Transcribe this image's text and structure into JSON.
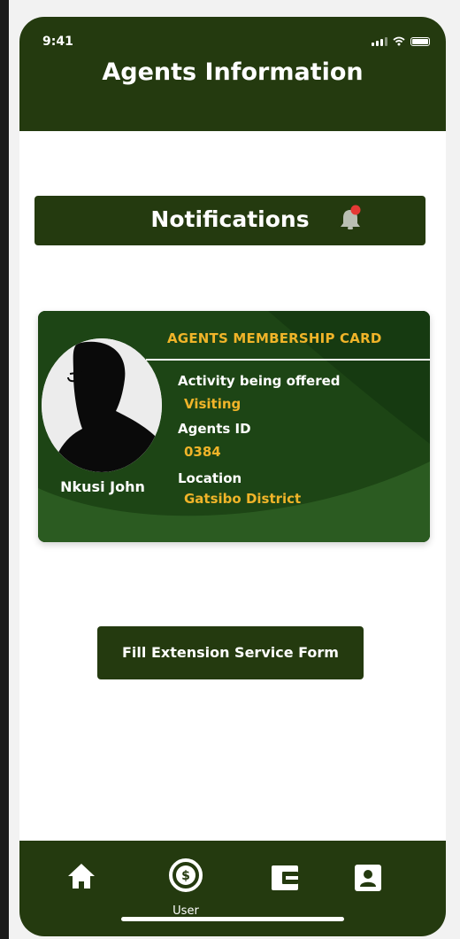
{
  "status_bar": {
    "time": "9:41"
  },
  "header": {
    "title": "Agents Information"
  },
  "notifications": {
    "label": "Notifications",
    "has_unread": true,
    "badge_color": "#e53935"
  },
  "card": {
    "title": "AGENTS  MEMBERSHIP CARD",
    "name": "Nkusi John",
    "fields": [
      {
        "label": "Activity being offered",
        "value": "Visiting"
      },
      {
        "label": "Agents ID",
        "value": "0384"
      },
      {
        "label": "Location",
        "value": "Gatsibo District"
      }
    ]
  },
  "actions": {
    "fill_form_label": "Fill Extension Service  Form"
  },
  "tab_bar": {
    "items": [
      {
        "icon": "home-icon",
        "label": ""
      },
      {
        "icon": "dollar-circle-icon",
        "label": "User"
      },
      {
        "icon": "wallet-icon",
        "label": ""
      },
      {
        "icon": "contact-card-icon",
        "label": ""
      }
    ]
  },
  "colors": {
    "primary": "#243a0f",
    "accent": "#f0b429",
    "card": "#1d4515",
    "background": "#ffffff"
  }
}
